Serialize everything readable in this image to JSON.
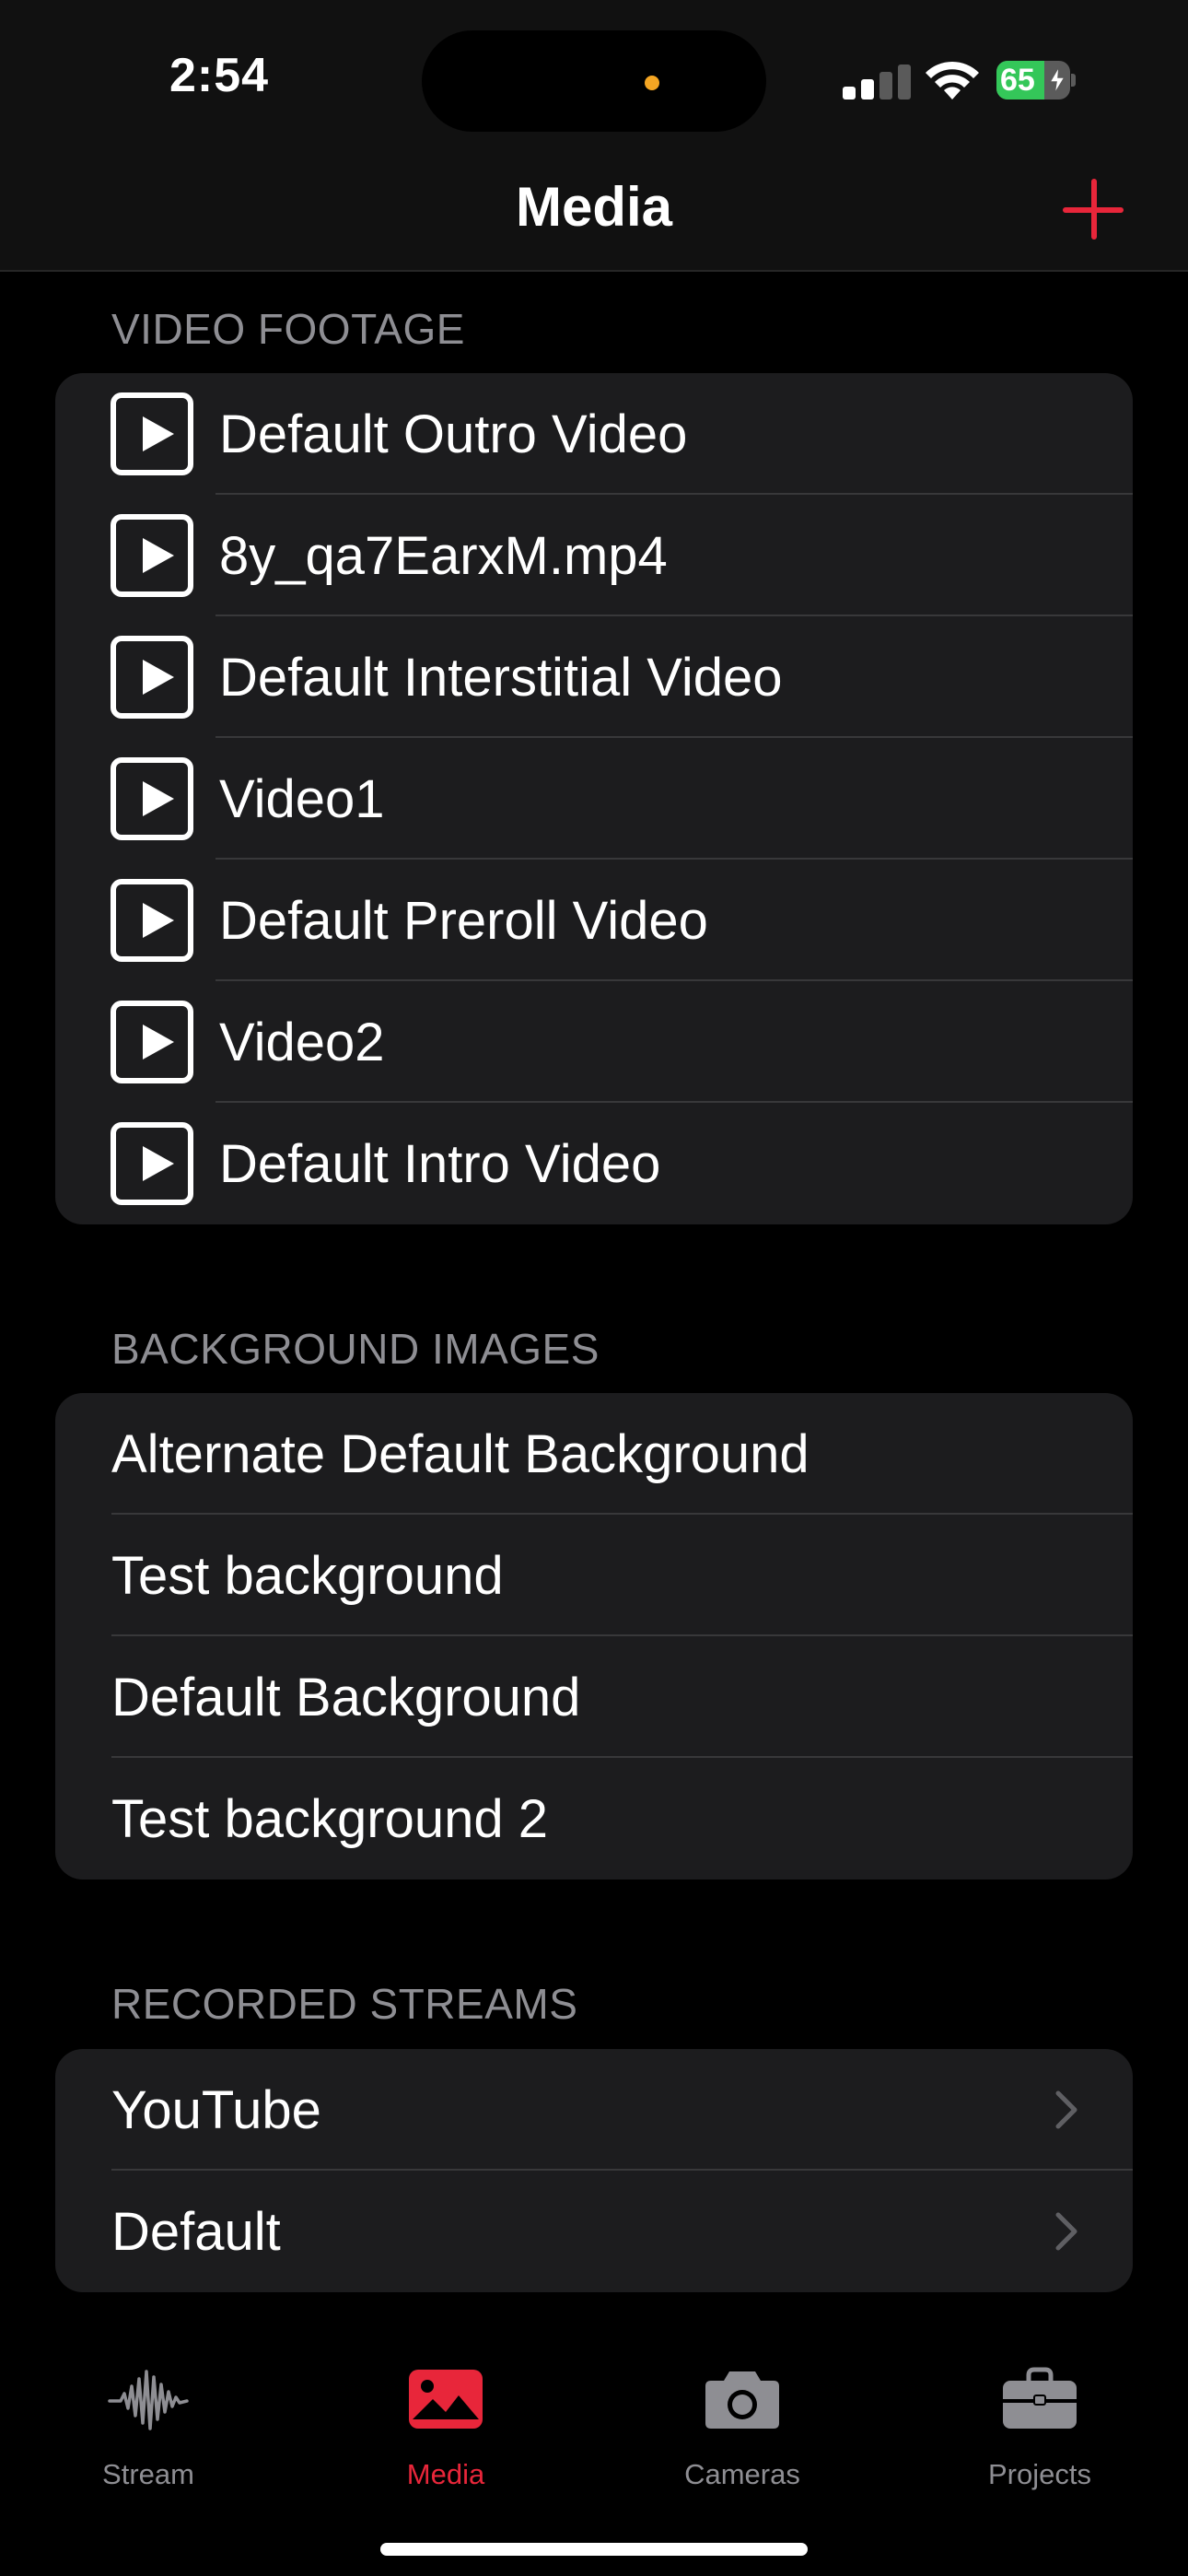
{
  "status_bar": {
    "time": "2:54",
    "battery_level": "65",
    "battery_fraction": 0.65,
    "battery_color": "#34c759",
    "recording_dot_color": "#f5a623",
    "signal_bars_active": 2,
    "icons": [
      "signal-icon",
      "wifi-icon",
      "battery-icon",
      "charging-bolt-icon"
    ]
  },
  "nav": {
    "title": "Media",
    "add_icon": "plus-icon",
    "accent_color": "#e8263a"
  },
  "sections": {
    "video_footage": {
      "header": "VIDEO FOOTAGE",
      "items": [
        "Default Outro Video",
        "8y_qa7EarxM.mp4",
        "Default Interstitial Video",
        "Video1",
        "Default Preroll Video",
        "Video2",
        "Default Intro Video"
      ],
      "item_icon": "play-icon"
    },
    "background_images": {
      "header": "BACKGROUND IMAGES",
      "items": [
        "Alternate Default Background",
        "Test background",
        "Default Background",
        "Test background 2"
      ]
    },
    "recorded_streams": {
      "header": "RECORDED STREAMS",
      "items": [
        "YouTube",
        "Default"
      ],
      "item_icon": "chevron-right-icon"
    }
  },
  "tab_bar": {
    "tabs": [
      {
        "label": "Stream",
        "icon": "waveform-icon",
        "active": false
      },
      {
        "label": "Media",
        "icon": "photo-icon",
        "active": true
      },
      {
        "label": "Cameras",
        "icon": "camera-icon",
        "active": false
      },
      {
        "label": "Projects",
        "icon": "briefcase-icon",
        "active": false
      }
    ]
  }
}
